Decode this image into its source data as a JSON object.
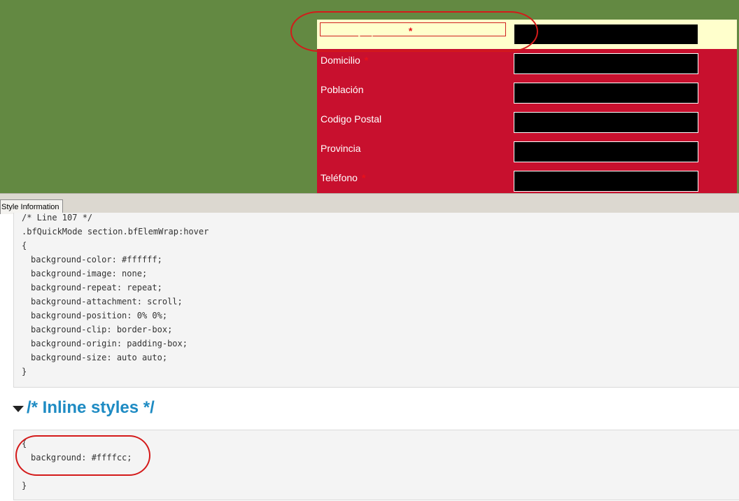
{
  "form": {
    "rows": [
      {
        "label": "Nombre y apellidos",
        "required": true,
        "value": ""
      },
      {
        "label": "Domicilio",
        "required": true,
        "value": ""
      },
      {
        "label": "Población",
        "required": false,
        "value": ""
      },
      {
        "label": "Codigo Postal",
        "required": false,
        "value": ""
      },
      {
        "label": "Provincia",
        "required": false,
        "value": ""
      },
      {
        "label": "Teléfono",
        "required": true,
        "value": ""
      }
    ],
    "required_mark": "*"
  },
  "devtools": {
    "tab_label": "Style Information",
    "rule1": {
      "comment": "/* Line 107 */",
      "selector": ".bfQuickMode section.bfElemWrap:hover",
      "open": "{",
      "declarations": [
        "background-color: #ffffff;",
        "background-image: none;",
        "background-repeat: repeat;",
        "background-attachment: scroll;",
        "background-position: 0% 0%;",
        "background-clip: border-box;",
        "background-origin: padding-box;",
        "background-size: auto auto;"
      ],
      "close": "}"
    },
    "inline_heading": "/* Inline styles */",
    "rule2": {
      "open": "{",
      "declarations": [
        "background: #ffffcc;"
      ],
      "close": "}"
    }
  },
  "colors": {
    "page_green": "#638942",
    "form_red": "#c8102e",
    "hover_yellow": "#ffffcc",
    "heading_blue": "#1e8bc3",
    "annotation_red": "#d41a1a"
  },
  "icons": {
    "section_toggle": "triangle-down-icon"
  }
}
